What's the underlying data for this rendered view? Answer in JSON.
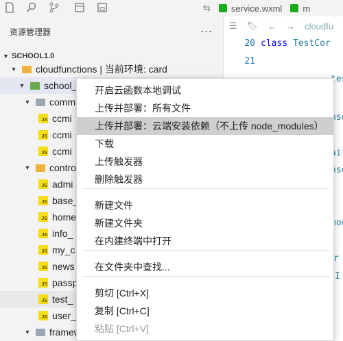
{
  "activity_icons": [
    "files-icon",
    "search-icon",
    "source-control-icon",
    "debug-icon",
    "extensions-icon"
  ],
  "tabs": [
    {
      "label": "service.wxml",
      "icon": "wxml-icon"
    },
    {
      "label": "m",
      "icon": "wxml-icon"
    }
  ],
  "sidebar": {
    "title": "资源管理器",
    "more": "···",
    "section": "SCHOOL1.0",
    "tree": [
      {
        "label": "cloudfunctions | 当前环境: card",
        "kind": "folder-orange",
        "caret": "▼",
        "indent": 14
      },
      {
        "label": "school_",
        "kind": "folder-green",
        "caret": "▼",
        "indent": 26,
        "selected": true
      },
      {
        "label": "comm",
        "kind": "folder-gray",
        "caret": "▼",
        "indent": 34
      },
      {
        "label": "ccmi",
        "kind": "js",
        "indent": 56
      },
      {
        "label": "ccmi",
        "kind": "js",
        "indent": 56
      },
      {
        "label": "ccmi",
        "kind": "js",
        "indent": 56
      },
      {
        "label": "contro",
        "kind": "folder-orange",
        "caret": "▼",
        "indent": 34
      },
      {
        "label": "admi",
        "kind": "js",
        "indent": 56
      },
      {
        "label": "base_",
        "kind": "js",
        "indent": 56
      },
      {
        "label": "home",
        "kind": "js",
        "indent": 56
      },
      {
        "label": "info_",
        "kind": "js",
        "indent": 56
      },
      {
        "label": "my_c",
        "kind": "js",
        "indent": 56
      },
      {
        "label": "news",
        "kind": "js",
        "indent": 56
      },
      {
        "label": "passp",
        "kind": "js",
        "indent": 56
      },
      {
        "label": "test_",
        "kind": "js",
        "indent": 56,
        "highlight": true
      },
      {
        "label": "user_",
        "kind": "js",
        "indent": 56
      },
      {
        "label": "framew",
        "kind": "folder-gray",
        "caret": "▼",
        "indent": 34
      }
    ]
  },
  "editor": {
    "breadcrumb": "cloudfu",
    "lines": [
      {
        "num": "20",
        "code": "class TestCor"
      },
      {
        "num": "21",
        "code": ""
      }
    ],
    "fragments": [
      "tes",
      "nso",
      "ait",
      "nso",
      "mod",
      "r",
      "I"
    ]
  },
  "context_menu": {
    "items": [
      {
        "label": "开启云函数本地调试",
        "enabled": true
      },
      {
        "label": "上传并部署：所有文件",
        "enabled": true
      },
      {
        "label": "上传并部署：云端安装依赖（不上传 node_modules）",
        "enabled": true,
        "active": true
      },
      {
        "label": "下载",
        "enabled": true
      },
      {
        "label": "上传触发器",
        "enabled": true
      },
      {
        "label": "删除触发器",
        "enabled": true
      },
      {
        "label": "新建文件",
        "enabled": true
      },
      {
        "label": "新建文件夹",
        "enabled": true
      },
      {
        "label": "在内建终端中打开",
        "enabled": true
      },
      {
        "label": "在文件夹中查找...",
        "enabled": true
      },
      {
        "label": "剪切  [Ctrl+X]",
        "enabled": true
      },
      {
        "label": "复制  [Ctrl+C]",
        "enabled": true
      },
      {
        "label": "粘贴  [Ctrl+V]",
        "enabled": false
      }
    ]
  },
  "colors": {
    "selection": "#e4e6f1",
    "menu_active": "#cfcfcf",
    "js": "#f5de19",
    "folder": "#f0b13c"
  }
}
